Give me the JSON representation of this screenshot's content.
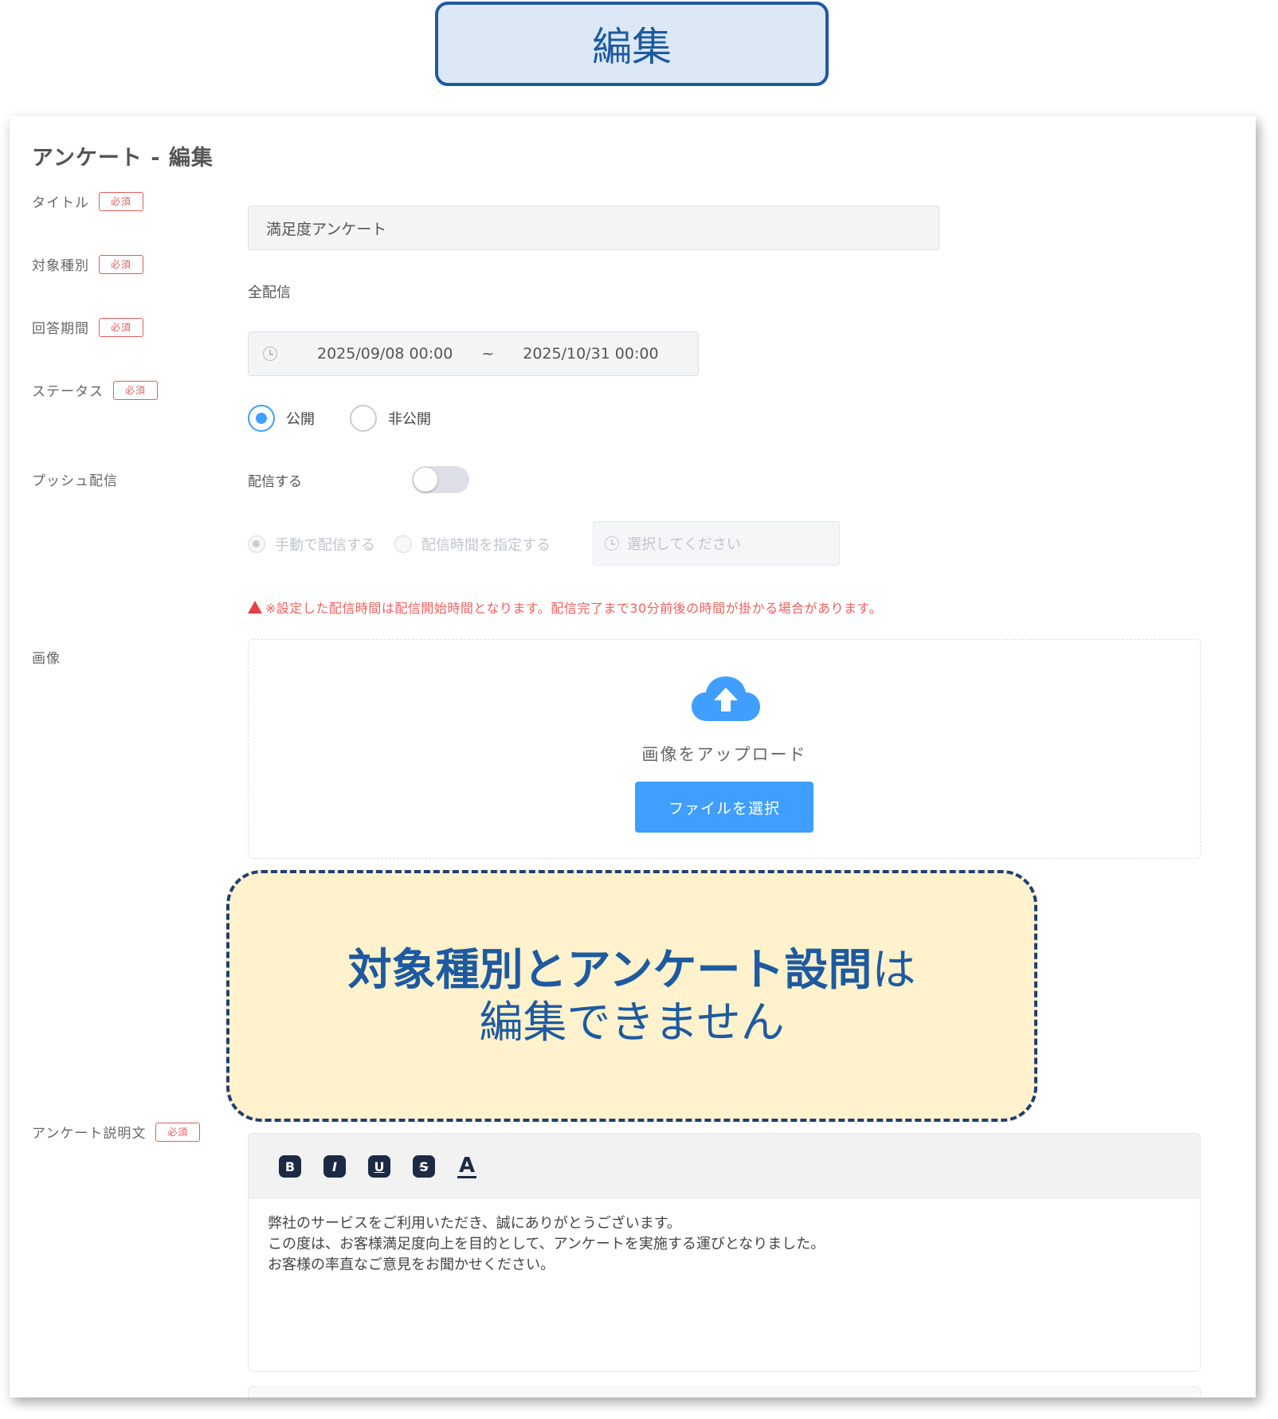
{
  "header_badge": "編集",
  "page_title": "アンケート - 編集",
  "required_label": "必須",
  "fields": {
    "title": {
      "label": "タイトル",
      "value": "満足度アンケート"
    },
    "target": {
      "label": "対象種別",
      "value": "全配信"
    },
    "period": {
      "label": "回答期間",
      "start": "2025/09/08 00:00",
      "separator": "~",
      "end": "2025/10/31 00:00"
    },
    "status": {
      "label": "ステータス",
      "options": [
        "公開",
        "非公開"
      ],
      "selected": "公開"
    },
    "push": {
      "label": "プッシュ配信",
      "toggle_label": "配信する",
      "toggle_on": false,
      "mode_options": [
        "手動で配信する",
        "配信時間を指定する"
      ],
      "time_placeholder": "選択してください",
      "warning": "※設定した配信時間は配信開始時間となります。配信完了まで30分前後の時間が掛かる場合があります。"
    },
    "image": {
      "label": "画像",
      "upload_text": "画像をアップロード",
      "button": "ファイルを選択"
    },
    "description": {
      "label": "アンケート説明文",
      "toolbar": [
        "B",
        "I",
        "U",
        "S",
        "A"
      ],
      "lines": [
        "弊社のサービスをご利用いただき、誠にありがとうございます。",
        "この度は、お客様満足度向上を目的として、アンケートを実施する運びとなりました。",
        "お客様の率直なご意見をお聞かせください。"
      ]
    }
  },
  "note": {
    "line1_bold": "対象種別とアンケート設問",
    "line1_normal": "は",
    "line2": "編集できません"
  },
  "colors": {
    "accent": "#409eff",
    "required": "#e25b5b",
    "note_bg": "#fff2cc",
    "note_text": "#1e5aa0",
    "warning": "#f06060"
  }
}
